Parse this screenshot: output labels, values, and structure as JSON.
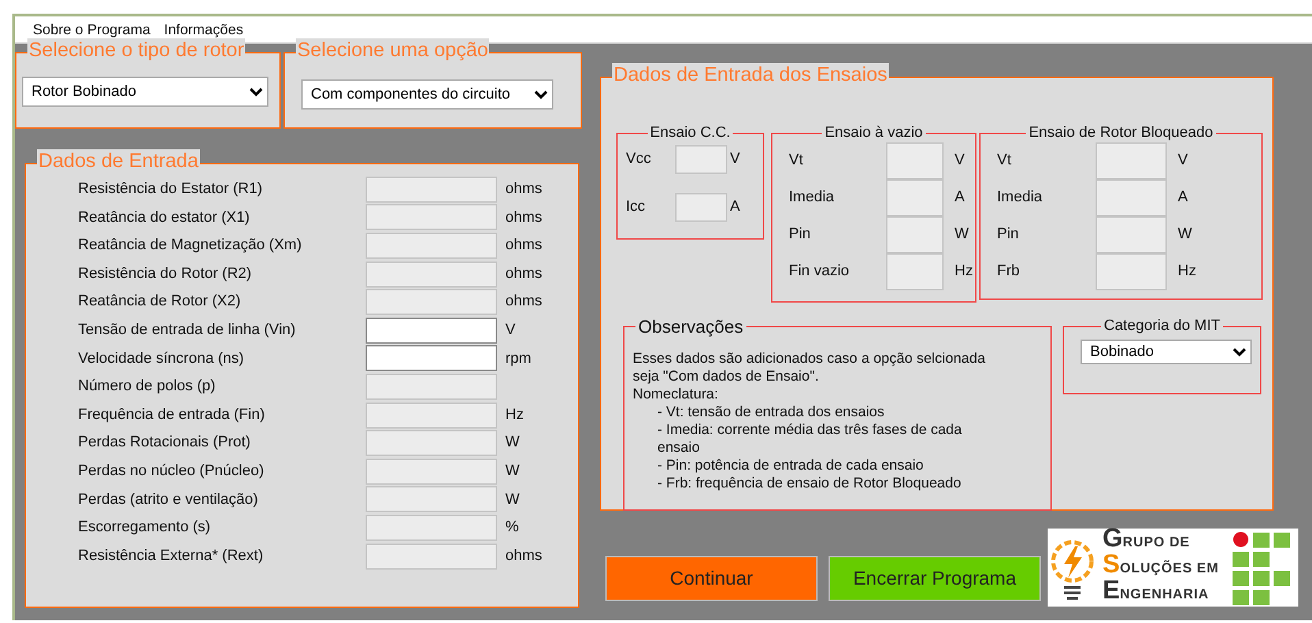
{
  "menu": [
    {
      "label": "Sobre o Programa"
    },
    {
      "label": "Informações"
    }
  ],
  "rotor_type": {
    "title": "Selecione o tipo de rotor",
    "value": "Rotor Bobinado"
  },
  "option": {
    "title": "Selecione uma opção",
    "value": "Com componentes do circuito"
  },
  "input_data": {
    "title": "Dados de Entrada",
    "fields": [
      {
        "label": "Resistência do Estator (R1)",
        "unit": "ohms",
        "disabled": true
      },
      {
        "label": "Reatância do estator (X1)",
        "unit": "ohms",
        "disabled": true
      },
      {
        "label": "Reatância de Magnetização (Xm)",
        "unit": "ohms",
        "disabled": true
      },
      {
        "label": "Resistência do Rotor (R2)",
        "unit": "ohms",
        "disabled": true
      },
      {
        "label": "Reatância de Rotor (X2)",
        "unit": "ohms",
        "disabled": true
      },
      {
        "label": "Tensão de entrada de linha (Vin)",
        "unit": "V",
        "disabled": false
      },
      {
        "label": "Velocidade síncrona (ns)",
        "unit": "rpm",
        "disabled": false
      },
      {
        "label": "Número de polos (p)",
        "disabled": true
      },
      {
        "label": "Frequência de entrada (Fin)",
        "unit": "Hz",
        "disabled": true
      },
      {
        "label": "Perdas Rotacionais (Prot)",
        "unit": "W",
        "disabled": true
      },
      {
        "label": "Perdas no núcleo (Pnúcleo)",
        "unit": "W",
        "disabled": true
      },
      {
        "label": "Perdas (atrito e ventilação)",
        "unit": "W",
        "disabled": true
      },
      {
        "label": "Escorregamento (s)",
        "unit": "%",
        "disabled": true
      },
      {
        "label": "Resistência Externa* (Rext)",
        "unit": "ohms",
        "disabled": true
      }
    ]
  },
  "tests": {
    "title": "Dados de Entrada dos Ensaios",
    "groups": [
      {
        "title": "Ensaio C.C.",
        "kind": "small",
        "fields": [
          {
            "label": "Vcc",
            "unit": "V",
            "disabled": true
          },
          {
            "label": "Icc",
            "unit": "A",
            "disabled": true
          }
        ]
      },
      {
        "title": "Ensaio à vazio",
        "kind": "tall",
        "fields": [
          {
            "label": "Vt",
            "unit": "V",
            "disabled": true
          },
          {
            "label": "Imedia",
            "unit": "A",
            "disabled": true
          },
          {
            "label": "Pin",
            "unit": "W",
            "disabled": true
          },
          {
            "label": "Fin vazio",
            "unit": "Hz",
            "disabled": true
          }
        ]
      },
      {
        "title": "Ensaio de Rotor Bloqueado",
        "kind": "tall",
        "fields": [
          {
            "label": "Vt",
            "unit": "V",
            "disabled": true
          },
          {
            "label": "Imedia",
            "unit": "A",
            "disabled": true
          },
          {
            "label": "Pin",
            "unit": "W",
            "disabled": true
          },
          {
            "label": "Frb",
            "unit": "Hz",
            "disabled": true
          }
        ]
      }
    ],
    "notes": {
      "title": "Observações",
      "lines": [
        {
          "kind": "text",
          "text": "Esses dados são adicionados caso a opção selcionada seja \"Com dados de Ensaio\"."
        },
        {
          "kind": "text",
          "text": "Nomeclatura:"
        },
        {
          "kind": "item",
          "text": "- Vt: tensão de entrada dos ensaios"
        },
        {
          "kind": "item",
          "text": "- Imedia: corrente média das três fases de cada ensaio"
        },
        {
          "kind": "item",
          "text": "- Pin: potência de entrada de cada ensaio"
        },
        {
          "kind": "item",
          "text": "- Frb: frequência de ensaio de Rotor Bloqueado"
        }
      ]
    },
    "category": {
      "title": "Categoria do MIT",
      "value": "Bobinado"
    }
  },
  "buttons": [
    {
      "label": "Continuar",
      "color": "#ff6600"
    },
    {
      "label": "Encerrar Programa",
      "color": "#66cc00"
    }
  ],
  "logo": {
    "lines": [
      {
        "initial": "G",
        "rest": "RUPO DE"
      },
      {
        "initial": "S",
        "rest": "OLUÇÕES EM"
      },
      {
        "initial": "E",
        "rest": "NGENHARIA"
      }
    ]
  }
}
